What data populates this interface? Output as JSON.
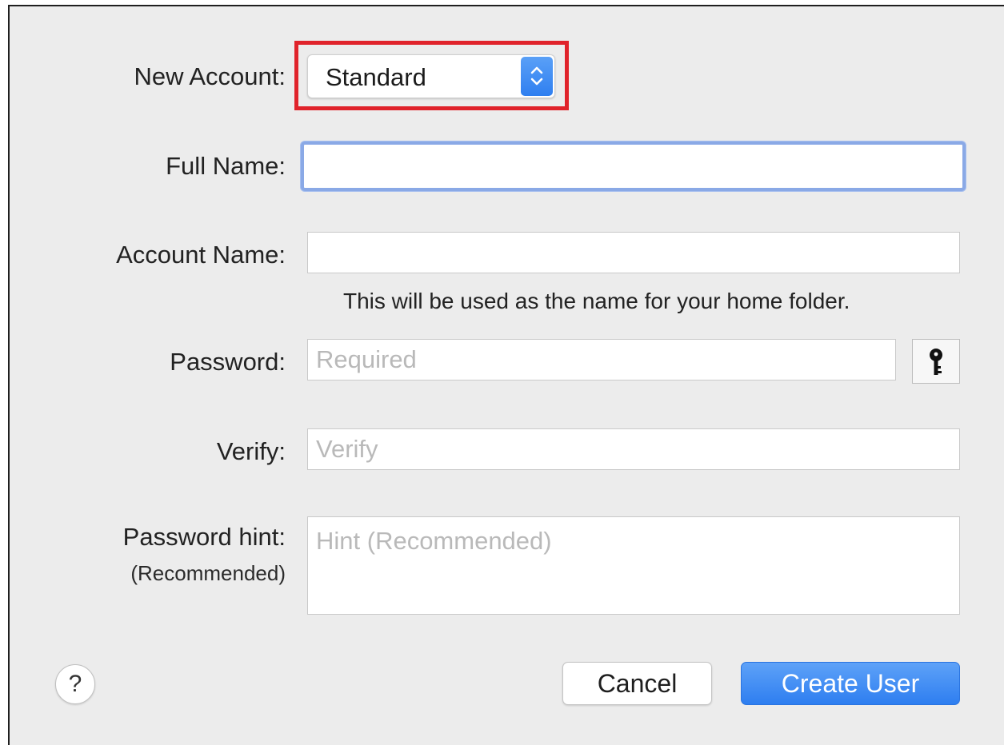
{
  "form": {
    "account_type_label": "New Account:",
    "account_type_value": "Standard",
    "full_name_label": "Full Name:",
    "full_name_value": "",
    "account_name_label": "Account Name:",
    "account_name_value": "",
    "account_name_help": "This will be used as the name for your home folder.",
    "password_label": "Password:",
    "password_placeholder": "Required",
    "verify_label": "Verify:",
    "verify_placeholder": "Verify",
    "hint_label": "Password hint:",
    "hint_sublabel": "(Recommended)",
    "hint_placeholder": "Hint (Recommended)"
  },
  "actions": {
    "help_label": "?",
    "cancel_label": "Cancel",
    "create_label": "Create User"
  },
  "colors": {
    "accent": "#3b86f3",
    "highlight": "#e0232b",
    "focus_ring": "#8aa9e6"
  },
  "icons": {
    "stepper": "chevron-updown-icon",
    "password_assistant": "key-icon"
  }
}
